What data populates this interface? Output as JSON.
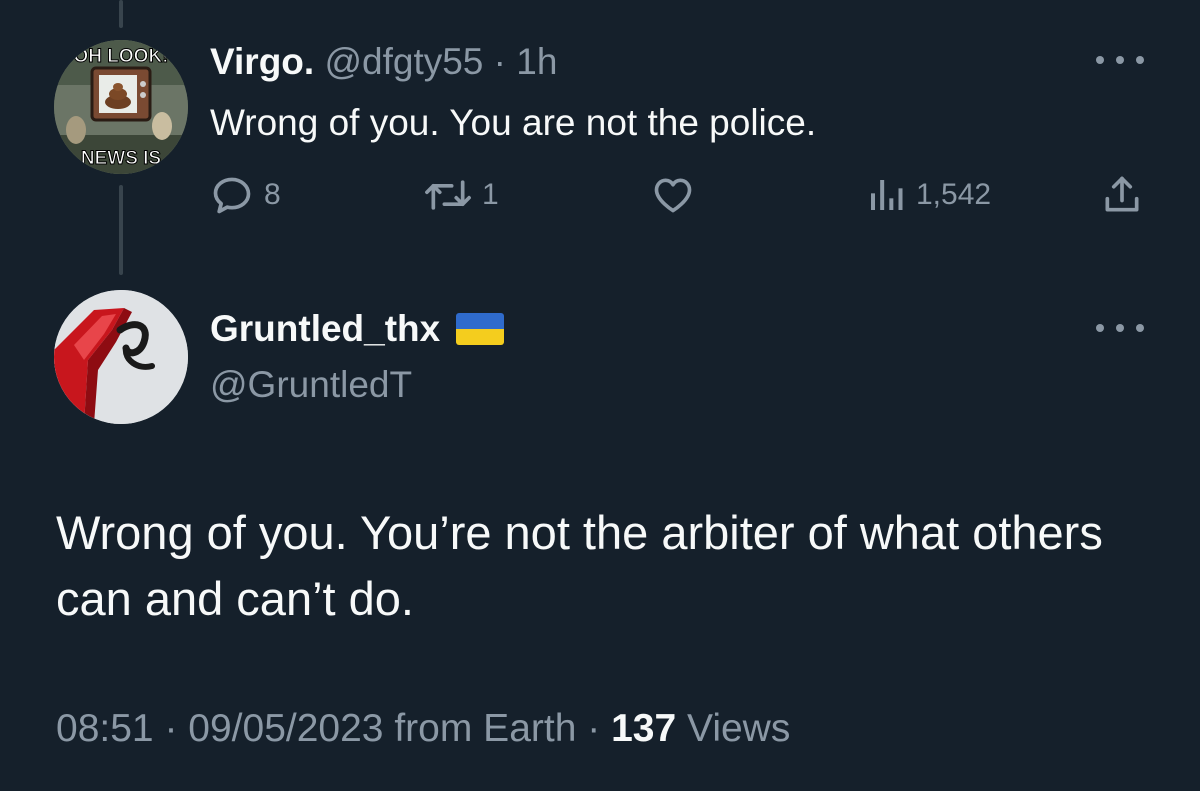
{
  "reply_tweet": {
    "display_name": "Virgo.",
    "handle": "@dfgty55",
    "separator": "·",
    "time": "1h",
    "text": "Wrong of you. You are not the police.",
    "avatar_caption_top": "OH LOOK!",
    "avatar_caption_bottom": "NEWS IS",
    "metrics": {
      "replies": "8",
      "retweets": "1",
      "likes": "",
      "views": "1,542"
    }
  },
  "main_tweet": {
    "display_name": "Gruntled_thx",
    "handle": "@GruntledT",
    "flag_icon": "ukraine-flag-icon",
    "text": "Wrong of you. You’re not the arbiter of what others can and can’t do.",
    "footer": {
      "time": "08:51",
      "separator": "·",
      "date": "09/05/2023",
      "source": "from Earth",
      "views_count": "137",
      "views_label": "Views"
    }
  },
  "colors": {
    "background": "#15202b",
    "primary_text": "#f7f9f9",
    "secondary_text": "#8b98a5",
    "thread_line": "#38444d"
  },
  "icons": {
    "reply": "speech-bubble-icon",
    "retweet": "retweet-arrows-icon",
    "like": "heart-icon",
    "views": "bar-chart-icon",
    "share": "upload-arrow-icon",
    "more": "ellipsis-icon"
  }
}
